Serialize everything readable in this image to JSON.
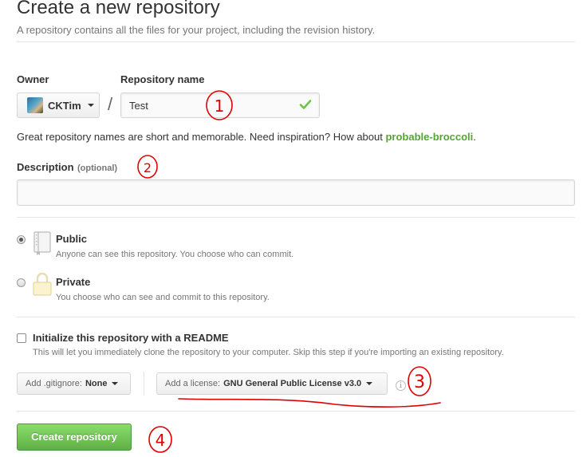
{
  "header": {
    "title": "Create a new repository",
    "subtitle": "A repository contains all the files for your project, including the revision history."
  },
  "owner": {
    "label": "Owner",
    "value": "CKTim"
  },
  "repository": {
    "label": "Repository name",
    "separator": "/",
    "value": "Test",
    "status_icon": "check-icon"
  },
  "hint": {
    "text": "Great repository names are short and memorable. Need inspiration? How about ",
    "suggestion": "probable-broccoli",
    "end": "."
  },
  "description": {
    "label": "Description",
    "optional": "(optional)",
    "value": ""
  },
  "visibility": {
    "selected": "public",
    "public": {
      "title": "Public",
      "desc": "Anyone can see this repository. You choose who can commit.",
      "icon": "book-icon"
    },
    "private": {
      "title": "Private",
      "desc": "You choose who can see and commit to this repository.",
      "icon": "lock-icon"
    }
  },
  "readme": {
    "checked": false,
    "title": "Initialize this repository with a README",
    "desc": "This will let you immediately clone the repository to your computer. Skip this step if you're importing an existing repository."
  },
  "gitignore": {
    "prefix": "Add .gitignore:",
    "value": "None"
  },
  "license": {
    "prefix": "Add a license:",
    "value": "GNU General Public License v3.0"
  },
  "submit": {
    "label": "Create repository"
  },
  "annotations": [
    "1",
    "2",
    "3",
    "4"
  ],
  "colors": {
    "accent_green": "#55a532",
    "button_green": "#60b044",
    "annotation_red": "#e00000"
  }
}
